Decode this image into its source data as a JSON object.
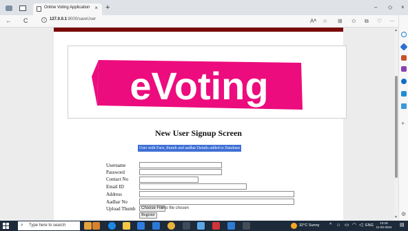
{
  "browser": {
    "tab_title": "Online Voting Application",
    "tab_close": "×",
    "new_tab": "+",
    "window_controls": {
      "minimize": "–",
      "restore": "◇",
      "close": "×"
    },
    "nav": {
      "back": "←",
      "refresh": "C",
      "info": "i"
    },
    "url_host": "127.0.0.1",
    "url_path": ":8000/saveUser",
    "toolbar_icons": [
      "read-aloud-icon",
      "favorite-star-icon",
      "split-screen-icon",
      "favorites-icon",
      "collections-icon",
      "browser-essentials-icon",
      "more-icon",
      "copilot-icon"
    ],
    "toolbar_glyphs": {
      "read_aloud": "Aᴬ",
      "favorite": "☆",
      "split": "⊞",
      "favorites": "✩",
      "collections": "⧉",
      "essentials": "♡",
      "more": "···"
    }
  },
  "page": {
    "logo_text": "eVoting",
    "heading": "New User Signup Screen",
    "message": "User with Face, thumb and aadhar Details added to Database",
    "form": {
      "fields": [
        {
          "label": "Username",
          "value": ""
        },
        {
          "label": "Password",
          "value": ""
        },
        {
          "label": "Contact No",
          "value": ""
        },
        {
          "label": "Email ID",
          "value": ""
        },
        {
          "label": "Address",
          "value": ""
        },
        {
          "label": "Aadhar No",
          "value": ""
        }
      ],
      "upload_label": "Upload Thumb",
      "choose_file": "Choose File",
      "no_file": "No file chosen",
      "register": "Register"
    }
  },
  "taskbar": {
    "search_placeholder": "Type here to search",
    "weather": "32°C  Sunny",
    "language": "ENG",
    "time": "13:18",
    "date": "11-03-2024"
  },
  "colors": {
    "accent_red": "#7a0a0a",
    "logo_pink": "#ec0c7e",
    "message_bg": "#3d6fd6",
    "taskbar_bg": "#1c2a3a"
  }
}
